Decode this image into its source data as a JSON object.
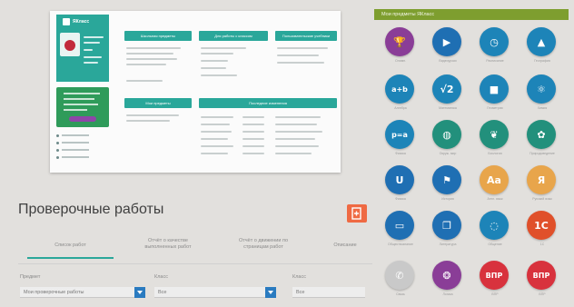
{
  "screenshot": {
    "brand": "ЯКласс",
    "cards": {
      "top": [
        "Школьная предметы",
        "Для работы с классом",
        "Пользовательские учебники"
      ],
      "bottom": [
        "Мои предметы",
        "Последние изменения"
      ]
    }
  },
  "page": {
    "title": "Проверочные работы"
  },
  "tabs": [
    {
      "label": "Список работ",
      "active": true
    },
    {
      "label": "Отчёт о качестве выполненных работ",
      "active": false
    },
    {
      "label": "Отчёт о движении по страницам работ",
      "active": false
    },
    {
      "label": "Описание",
      "active": false
    }
  ],
  "filters": [
    {
      "label": "Предмет",
      "value": "Мои проверочные работы"
    },
    {
      "label": "Класс",
      "value": "Все"
    },
    {
      "label": "Класс",
      "value": "Все"
    }
  ],
  "icon_grid": {
    "title": "Мои предметы ЯКласс",
    "tiles": [
      {
        "icon": "trophy-icon",
        "glyph": "🏆",
        "color": "#8a3d97",
        "label": "Олимп."
      },
      {
        "icon": "book-play-icon",
        "glyph": "▶",
        "color": "#1f6fb3",
        "label": "Видеоуроки"
      },
      {
        "icon": "clock-icon",
        "glyph": "◷",
        "color": "#1d84b8",
        "label": "Расписание"
      },
      {
        "icon": "mountain-icon",
        "glyph": "▲",
        "color": "#1d84b8",
        "label": "География"
      },
      {
        "icon": "formula-icon",
        "glyph": "a+b",
        "color": "#1d84b8",
        "label": "Алгебра"
      },
      {
        "icon": "sqrt-icon",
        "glyph": "√2",
        "color": "#1d84b8",
        "label": "Математика"
      },
      {
        "icon": "cube-icon",
        "glyph": "■",
        "color": "#1d84b8",
        "label": "Геометрия"
      },
      {
        "icon": "molecule-icon",
        "glyph": "⚛",
        "color": "#1d84b8",
        "label": "Химия"
      },
      {
        "icon": "physics-formula-icon",
        "glyph": "p=a",
        "color": "#1d84b8",
        "label": "Физика"
      },
      {
        "icon": "globe-icon",
        "glyph": "◍",
        "color": "#22907c",
        "label": "Окруж. мир"
      },
      {
        "icon": "leaf-icon",
        "glyph": "❦",
        "color": "#22907c",
        "label": "Биология"
      },
      {
        "icon": "bug-icon",
        "glyph": "✿",
        "color": "#22907c",
        "label": "Природоведение"
      },
      {
        "icon": "magnet-icon",
        "glyph": "U",
        "color": "#1f6fb3",
        "label": "Физика"
      },
      {
        "icon": "flag-icon",
        "glyph": "⚑",
        "color": "#1f6fb3",
        "label": "История"
      },
      {
        "icon": "translate-icon",
        "glyph": "Aa",
        "color": "#e8a54b",
        "label": "Англ. язык"
      },
      {
        "icon": "language-icon",
        "glyph": "Я",
        "color": "#e8a54b",
        "label": "Русский язык"
      },
      {
        "icon": "id-card-icon",
        "glyph": "▭",
        "color": "#1f6fb3",
        "label": "Обществознание"
      },
      {
        "icon": "open-book-icon",
        "glyph": "❐",
        "color": "#1f6fb3",
        "label": "Литература"
      },
      {
        "icon": "chat-icon",
        "glyph": "◌",
        "color": "#1d84b8",
        "label": "Общение"
      },
      {
        "icon": "onec-icon",
        "glyph": "1С",
        "color": "#e0502a",
        "label": "1С"
      },
      {
        "icon": "phone-icon",
        "glyph": "✆",
        "color": "#c9c9c9",
        "label": "Связь"
      },
      {
        "icon": "brain-icon",
        "glyph": "❂",
        "color": "#8a3d97",
        "label": "Логика"
      },
      {
        "icon": "vpr-icon",
        "glyph": "ВПР",
        "color": "#d8323d",
        "label": "ВПР"
      },
      {
        "icon": "vpr-icon",
        "glyph": "ВПР",
        "color": "#d8323d",
        "label": "ВПР"
      }
    ]
  }
}
